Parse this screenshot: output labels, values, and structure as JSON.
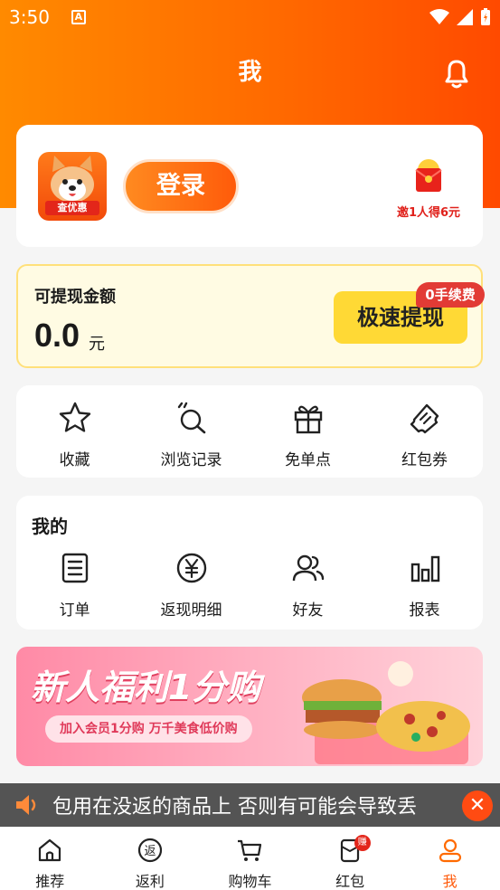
{
  "status_bar": {
    "time": "3:50",
    "app_icon": "A"
  },
  "header": {
    "title": "我"
  },
  "login_card": {
    "login_label": "登录",
    "avatar_tag": "查优惠",
    "invite_text": "邀1人得6元"
  },
  "cash": {
    "label": "可提现金额",
    "amount": "0.0",
    "unit": "元",
    "withdraw_label": "极速提现",
    "fee_badge": "0手续费"
  },
  "quick_links": [
    {
      "label": "收藏",
      "icon": "star-icon"
    },
    {
      "label": "浏览记录",
      "icon": "history-icon"
    },
    {
      "label": "免单点",
      "icon": "gift-icon"
    },
    {
      "label": "红包券",
      "icon": "ticket-icon"
    }
  ],
  "mine": {
    "title": "我的",
    "items": [
      {
        "label": "订单",
        "icon": "order-icon"
      },
      {
        "label": "返现明细",
        "icon": "yen-icon"
      },
      {
        "label": "好友",
        "icon": "friends-icon"
      },
      {
        "label": "报表",
        "icon": "chart-icon"
      }
    ]
  },
  "banner": {
    "headline": "新人福利1分购",
    "subtitle": "加入会员1分购 万千美食低价购"
  },
  "marquee": {
    "text": "包用在没返的商品上 否则有可能会导致丢"
  },
  "tabbar": [
    {
      "label": "推荐",
      "icon": "home-icon"
    },
    {
      "label": "返利",
      "icon": "rebate-icon"
    },
    {
      "label": "购物车",
      "icon": "cart-icon"
    },
    {
      "label": "红包",
      "icon": "redpacket-icon",
      "badge": "赚"
    },
    {
      "label": "我",
      "icon": "profile-icon"
    }
  ],
  "colors": {
    "brand": "#ff6a00",
    "accent_red": "#e3261a",
    "yellow": "#ffd935"
  }
}
